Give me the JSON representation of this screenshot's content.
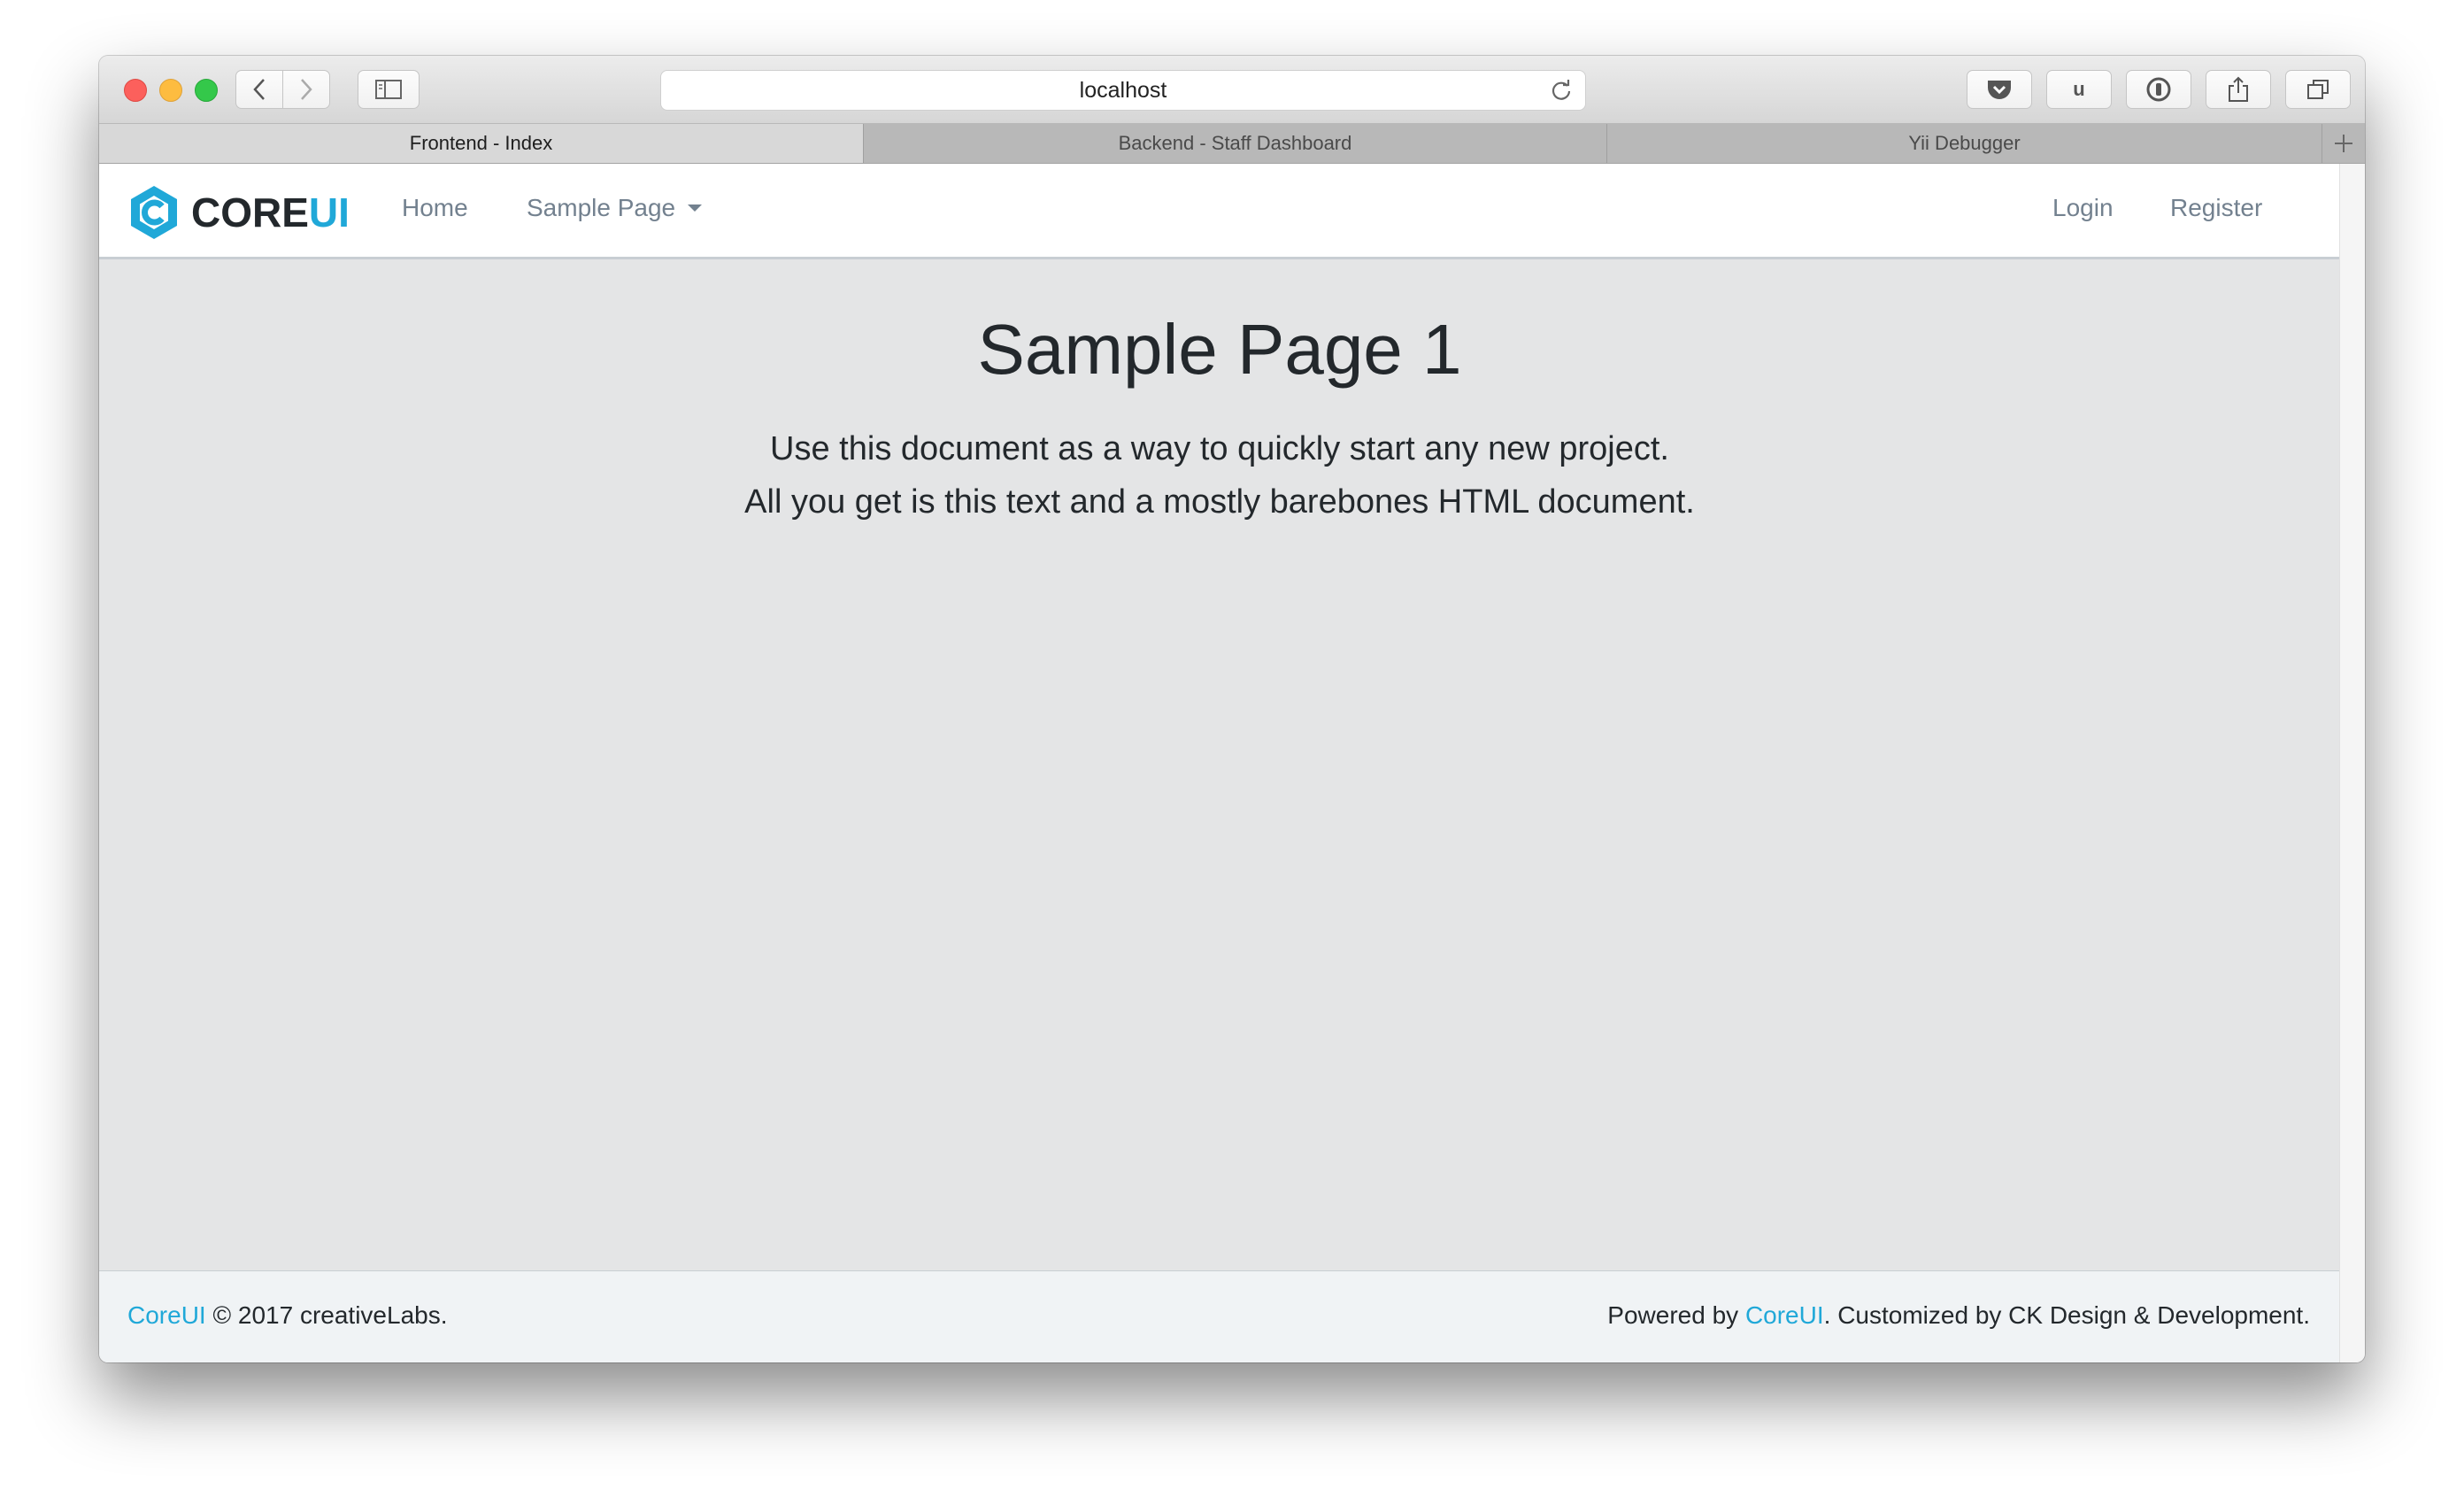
{
  "browser": {
    "url": "localhost",
    "tabs": [
      {
        "label": "Frontend - Index",
        "active": true
      },
      {
        "label": "Backend - Staff Dashboard",
        "active": false
      },
      {
        "label": "Yii Debugger",
        "active": false
      }
    ],
    "extension_u_label": "u"
  },
  "navbar": {
    "brand_core": "CORE",
    "brand_ui": "UI",
    "home": "Home",
    "sample_page": "Sample Page",
    "login": "Login",
    "register": "Register"
  },
  "main": {
    "title": "Sample Page 1",
    "lead_line1": "Use this document as a way to quickly start any new project.",
    "lead_line2": "All you get is this text and a mostly barebones HTML document."
  },
  "footer": {
    "left_link": "CoreUI",
    "left_text": " © 2017 creativeLabs.",
    "right_prefix": "Powered by ",
    "right_link": "CoreUI",
    "right_suffix": ". Customized by CK Design & Development."
  },
  "colors": {
    "accent": "#20a8d8",
    "text": "#23282c",
    "nav_link": "#73818f",
    "page_bg": "#e4e5e6",
    "footer_bg": "#f0f3f5"
  }
}
